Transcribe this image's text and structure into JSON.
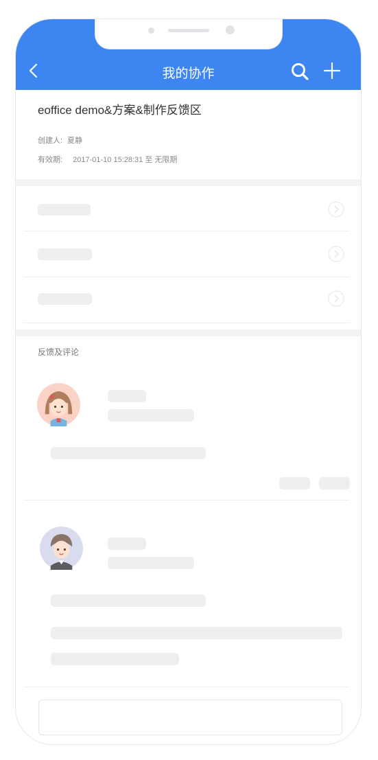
{
  "header": {
    "title": "我的协作",
    "back_icon": "chevron-left-icon",
    "search_icon": "search-icon",
    "add_icon": "plus-icon",
    "bg_color": "#3d86f2"
  },
  "collab": {
    "name": "eoffice demo&方案&制作反馈区",
    "creator_label": "创建人:",
    "creator": "夏静",
    "validity_label": "有效期:",
    "validity": "2017-01-10  15:28:31 至 无限期"
  },
  "feedback": {
    "section_label": "反馈及评论"
  }
}
